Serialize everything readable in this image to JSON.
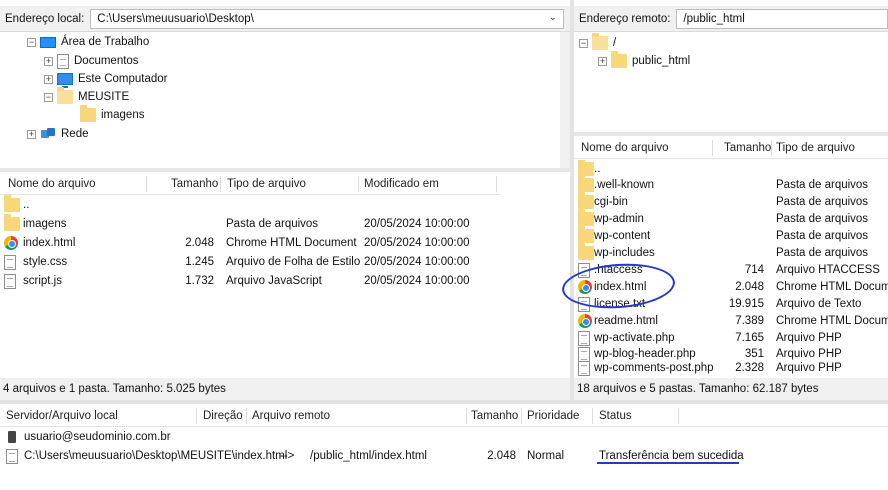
{
  "local": {
    "address_label": "Endereço local:",
    "address_value": "C:\\Users\\meuusuario\\Desktop\\",
    "tree": [
      {
        "label": "Área de Trabalho",
        "icon": "desktop-icon"
      },
      {
        "label": "Documentos",
        "icon": "documents-icon"
      },
      {
        "label": "Este Computador",
        "icon": "computer-icon"
      },
      {
        "label": "MEUSITE",
        "icon": "folder-icon"
      },
      {
        "label": "imagens",
        "icon": "folder-icon"
      },
      {
        "label": "Rede",
        "icon": "network-icon"
      }
    ],
    "columns": [
      "Nome do arquivo",
      "Tamanho",
      "Tipo de arquivo",
      "Modificado em"
    ],
    "files": [
      {
        "name": "..",
        "size": "",
        "type": "",
        "modified": "",
        "icon": "folder-icon"
      },
      {
        "name": "imagens",
        "size": "",
        "type": "Pasta de arquivos",
        "modified": "20/05/2024 10:00:00",
        "icon": "folder-icon"
      },
      {
        "name": "index.html",
        "size": "2.048",
        "type": "Chrome HTML Document",
        "modified": "20/05/2024 10:00:00",
        "icon": "chrome-icon"
      },
      {
        "name": "style.css",
        "size": "1.245",
        "type": "Arquivo de Folha de Estilo",
        "modified": "20/05/2024 10:00:00",
        "icon": "file-icon"
      },
      {
        "name": "script.js",
        "size": "1.732",
        "type": "Arquivo JavaScript",
        "modified": "20/05/2024 10:00:00",
        "icon": "file-icon"
      }
    ],
    "status": "4 arquivos e 1 pasta. Tamanho: 5.025 bytes"
  },
  "remote": {
    "address_label": "Endereço remoto:",
    "address_value": "/public_html",
    "tree": [
      {
        "label": "/",
        "icon": "folder-icon"
      },
      {
        "label": "public_html",
        "icon": "folder-icon"
      }
    ],
    "columns": [
      "Nome do arquivo",
      "Tamanho",
      "Tipo de arquivo"
    ],
    "files": [
      {
        "name": "..",
        "size": "",
        "type": "",
        "icon": "folder-icon"
      },
      {
        "name": ".well-known",
        "size": "",
        "type": "Pasta de arquivos",
        "icon": "folder-icon"
      },
      {
        "name": "cgi-bin",
        "size": "",
        "type": "Pasta de arquivos",
        "icon": "folder-icon"
      },
      {
        "name": "wp-admin",
        "size": "",
        "type": "Pasta de arquivos",
        "icon": "folder-icon"
      },
      {
        "name": "wp-content",
        "size": "",
        "type": "Pasta de arquivos",
        "icon": "folder-icon"
      },
      {
        "name": "wp-includes",
        "size": "",
        "type": "Pasta de arquivos",
        "icon": "folder-icon"
      },
      {
        "name": ".htaccess",
        "size": "714",
        "type": "Arquivo HTACCESS",
        "icon": "file-icon"
      },
      {
        "name": "index.html",
        "size": "2.048",
        "type": "Chrome HTML Document",
        "icon": "chrome-icon"
      },
      {
        "name": "license.txt",
        "size": "19.915",
        "type": "Arquivo de Texto",
        "icon": "file-icon"
      },
      {
        "name": "readme.html",
        "size": "7.389",
        "type": "Chrome HTML Document",
        "icon": "chrome-icon"
      },
      {
        "name": "wp-activate.php",
        "size": "7.165",
        "type": "Arquivo PHP",
        "icon": "file-icon"
      },
      {
        "name": "wp-blog-header.php",
        "size": "351",
        "type": "Arquivo PHP",
        "icon": "file-icon"
      },
      {
        "name": "wp-comments-post.php",
        "size": "2.328",
        "type": "Arquivo PHP",
        "icon": "file-icon"
      }
    ],
    "status": "18 arquivos e 5 pastas. Tamanho: 62.187 bytes"
  },
  "queue": {
    "columns": [
      "Servidor/Arquivo local",
      "Direção",
      "Arquivo remoto",
      "Tamanho",
      "Prioridade",
      "Status"
    ],
    "server": "usuario@seudominio.com.br",
    "item": {
      "local_file": "C:\\Users\\meuusuario\\Desktop\\MEUSITE\\index.html",
      "direction": "-->",
      "remote_file": "/public_html/index.html",
      "size": "2.048",
      "priority": "Normal",
      "status": "Transferência bem sucedida"
    }
  },
  "colors": {
    "annotation": "#2438c9",
    "folder": "#f7d77a"
  }
}
